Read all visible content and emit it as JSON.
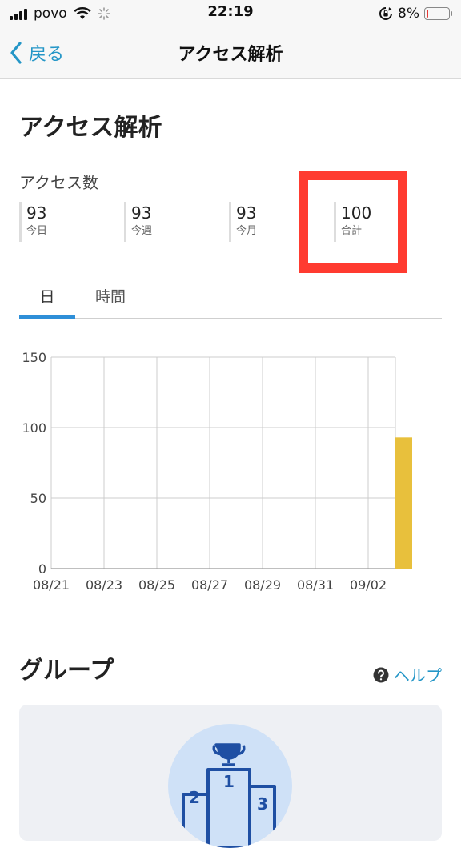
{
  "status_bar": {
    "carrier": "povo",
    "time": "22:19",
    "battery_percent": "8%",
    "battery_level": 0.08,
    "icons": [
      "signal-icon",
      "wifi-icon",
      "loading-icon",
      "rotation-lock-icon",
      "battery-icon"
    ]
  },
  "nav": {
    "back_label": "戻る",
    "title": "アクセス解析"
  },
  "main": {
    "title": "アクセス解析",
    "access_label": "アクセス数",
    "stats": [
      {
        "value": "93",
        "caption": "今日"
      },
      {
        "value": "93",
        "caption": "今週"
      },
      {
        "value": "93",
        "caption": "今月"
      },
      {
        "value": "100",
        "caption": "合計"
      }
    ],
    "tabs": [
      {
        "label": "日",
        "active": true
      },
      {
        "label": "時間",
        "active": false
      }
    ]
  },
  "chart_data": {
    "type": "bar",
    "title": "",
    "xlabel": "",
    "ylabel": "",
    "ylim": [
      0,
      150
    ],
    "yticks": [
      0,
      50,
      100,
      150
    ],
    "x_tick_labels": [
      "08/21",
      "08/23",
      "08/25",
      "08/27",
      "08/29",
      "08/31",
      "09/02"
    ],
    "grid": true,
    "bar_color": "#e8c03c",
    "bars": [
      {
        "date": "09/03",
        "value": 93
      }
    ]
  },
  "group": {
    "title": "グループ",
    "help_label": "ヘルプ",
    "podium_numbers": [
      "1",
      "2",
      "3"
    ]
  },
  "colors": {
    "accent": "#2496c7",
    "tab_indicator": "#2e8fd8",
    "highlight": "#ff3b30",
    "bar": "#e8c03c",
    "podium": "#1f4fa3"
  }
}
